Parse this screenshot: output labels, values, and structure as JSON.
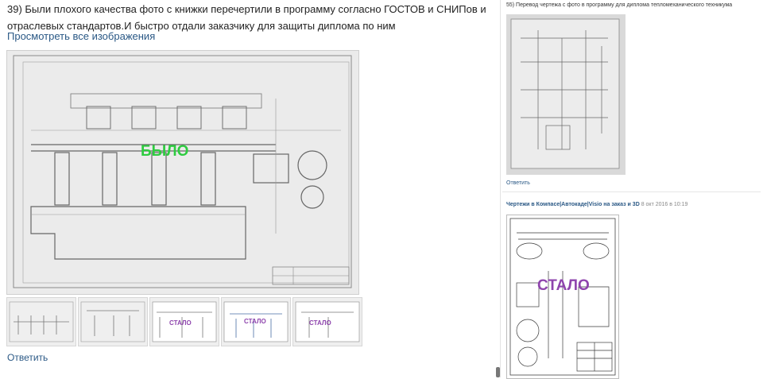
{
  "post": {
    "text": "39) Были плохого качества фото с книжки перечертили в программу согласно ГОСТОВ и СНИПов и отраслевых стандартов.И быстро отдали заказчику для защиты диплома по ним",
    "view_all": "Просмотреть все изображения",
    "main_overlay": "БЫЛО",
    "thumb_overlays": [
      "СТАЛО",
      "СТАЛО",
      "СТАЛО"
    ],
    "reply": "Ответить"
  },
  "right": {
    "post1_text": "55) Перевод чертежа с фото в программу для диплома тепломеханического техникума",
    "post1_reply": "Ответить",
    "post2_author": "Чертежи в Компасе|Автокаде|Visio на заказ и 3D",
    "post2_date": "8 окт 2016 в 10:19",
    "post2_overlay": "СТАЛО"
  },
  "colors": {
    "link": "#2a5885",
    "was_green": "#2ecc40",
    "became_purple": "#8e44ad"
  }
}
